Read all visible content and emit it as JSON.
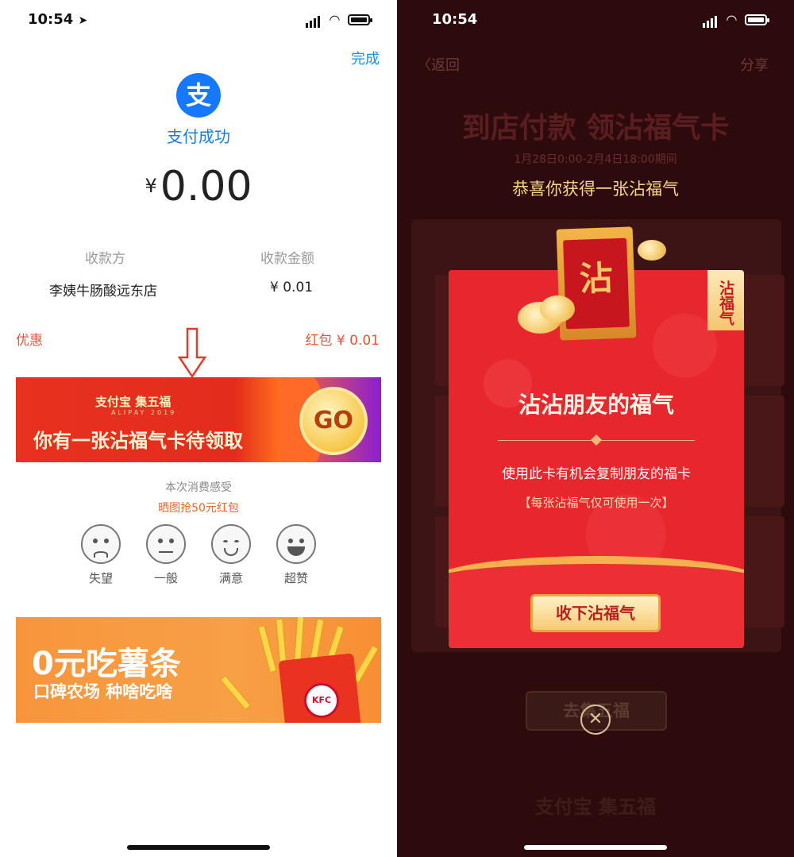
{
  "left": {
    "status_time": "10:54",
    "done_label": "完成",
    "alipay_icon_char": "支",
    "pay_success": "支付成功",
    "amount_currency": "¥",
    "amount_value": "0.00",
    "payee_header": "收款方",
    "payee_name": "李姨牛肠酸远东店",
    "paid_header": "收款金额",
    "paid_amount": "¥ 0.01",
    "discount_label": "优惠",
    "discount_value": "红包 ¥ 0.01",
    "fu_banner": {
      "brand": "支付宝 集五福",
      "brand_sub": "ALIPAY 2019",
      "headline": "你有一张沾福气卡待领取",
      "go_label": "GO"
    },
    "feedback": {
      "title": "本次消费感受",
      "subtitle": "晒图抢50元红包",
      "options": [
        "失望",
        "一般",
        "满意",
        "超赞"
      ]
    },
    "kfc_banner": {
      "title": "0元吃薯条",
      "subtitle": "口碑农场 种啥吃啥",
      "logo_text": "KFC"
    }
  },
  "right": {
    "status_time": "10:54",
    "back_label": "返回",
    "share_label": "分享",
    "bg_title": "到店付款 领沾福气卡",
    "bg_date": "1月28日0:00-2月4日18:00期间",
    "congrats": "恭喜你获得一张沾福气",
    "card": {
      "tag": "沾福气",
      "envelope_char": "沾",
      "title": "沾沾朋友的福气",
      "desc": "使用此卡有机会复制朋友的福卡",
      "note": "【每张沾福气仅可使用一次】",
      "receive_label": "收下沾福气"
    },
    "bg_collect": "去集五福",
    "close_icon": "close-icon",
    "bg_footer": "支付宝 集五福"
  },
  "colors": {
    "alipay_blue": "#1677ff",
    "red": "#e8262e",
    "gold": "#f6cb72",
    "dark_bg": "#2d0b0d"
  }
}
